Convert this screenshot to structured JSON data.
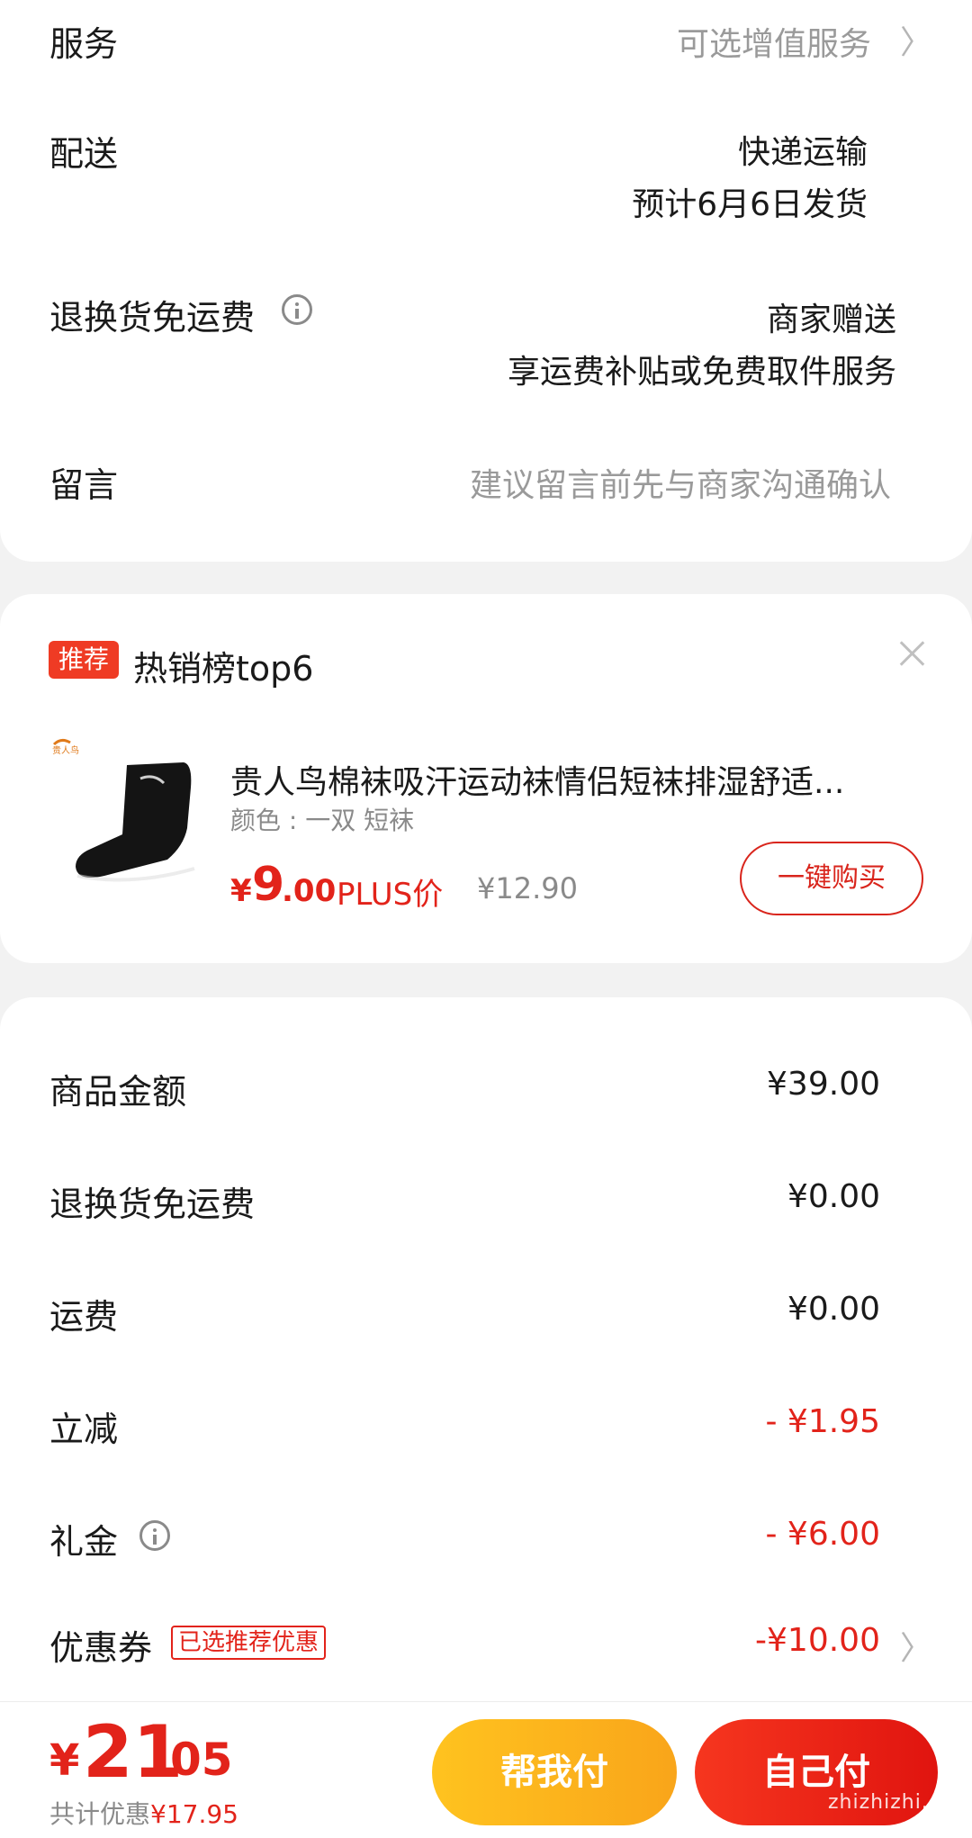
{
  "details": {
    "service": {
      "label": "服务",
      "value": "可选增值服务"
    },
    "delivery": {
      "label": "配送",
      "method": "快递运输",
      "eta": "预计6月6日发货"
    },
    "return_free": {
      "label": "退换货免运费",
      "value1": "商家赠送",
      "value2": "享运费补贴或免费取件服务"
    },
    "message": {
      "label": "留言",
      "placeholder": "建议留言前先与商家沟通确认"
    }
  },
  "recommend": {
    "badge": "推荐",
    "title": "热销榜top6",
    "product": {
      "name": "贵人鸟棉袜吸汗运动袜情侣短袜排湿舒适...",
      "spec": "颜色 : 一双 短袜",
      "price_currency": "¥",
      "price_int": "9",
      "price_dec": ".00",
      "price_tag": "PLUS价",
      "original_price": "¥12.90",
      "buy_label": "一键购买"
    }
  },
  "summary": {
    "goods": {
      "label": "商品金额",
      "value": "¥39.00"
    },
    "return_free": {
      "label": "退换货免运费",
      "value": "¥0.00"
    },
    "shipping": {
      "label": "运费",
      "value": "¥0.00"
    },
    "discount": {
      "label": "立减",
      "value": "- ¥1.95"
    },
    "gift": {
      "label": "礼金",
      "value": "- ¥6.00"
    },
    "coupon": {
      "label": "优惠券",
      "tag": "已选推荐优惠",
      "value": "-¥10.00"
    }
  },
  "bottom": {
    "currency": "¥",
    "total_int": "21",
    "total_dec": ".05",
    "saved_label": "共计优惠",
    "saved_value": "¥17.95",
    "help_pay": "帮我付",
    "self_pay": "自己付",
    "watermark": "zhizhizhi.com"
  },
  "colors": {
    "accent_red": "#e2231a",
    "accent_yellow": "#ffc31f"
  }
}
